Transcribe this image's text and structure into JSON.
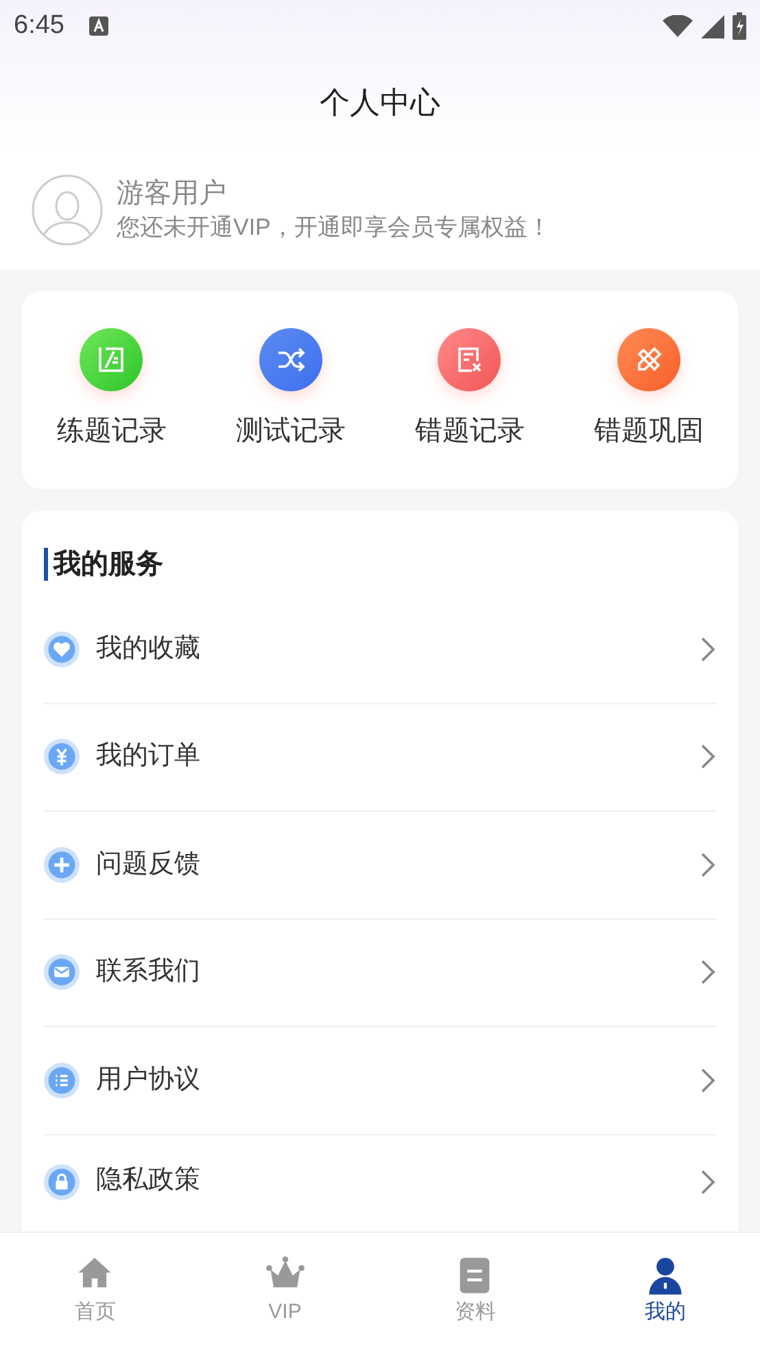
{
  "status_bar": {
    "time": "6:45"
  },
  "header": {
    "title": "个人中心"
  },
  "profile": {
    "name": "游客用户",
    "subtitle": "您还未开通VIP，开通即享会员专属权益！"
  },
  "quick_actions": [
    {
      "kind": "practice",
      "label": "练题记录"
    },
    {
      "kind": "test",
      "label": "测试记录"
    },
    {
      "kind": "wrong",
      "label": "错题记录"
    },
    {
      "kind": "review",
      "label": "错题巩固"
    }
  ],
  "services": {
    "title": "我的服务",
    "items": [
      {
        "kind": "heart",
        "label": "我的收藏"
      },
      {
        "kind": "yen",
        "label": "我的订单"
      },
      {
        "kind": "plus",
        "label": "问题反馈"
      },
      {
        "kind": "mail",
        "label": "联系我们"
      },
      {
        "kind": "list",
        "label": "用户协议"
      },
      {
        "kind": "lock",
        "label": "隐私政策"
      }
    ]
  },
  "tab_bar": [
    {
      "kind": "home",
      "label": "首页",
      "selected": false
    },
    {
      "kind": "crown",
      "label": "VIP",
      "selected": false
    },
    {
      "kind": "doc",
      "label": "资料",
      "selected": false
    },
    {
      "kind": "person",
      "label": "我的",
      "selected": true
    }
  ]
}
